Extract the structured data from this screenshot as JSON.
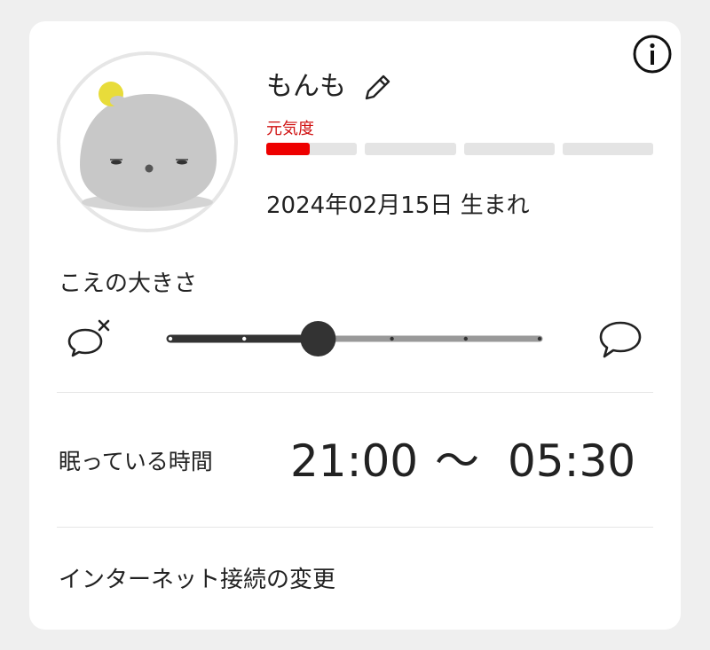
{
  "profile": {
    "name": "もんも",
    "energy_label": "元気度",
    "energy_level": 0.12,
    "energy_segments": 4,
    "birth_text": "2024年02月15日 生まれ"
  },
  "volume": {
    "label": "こえの大きさ",
    "steps": 6,
    "current_step": 2
  },
  "sleep": {
    "label": "眠っている時間",
    "start": "21:00",
    "separator": "～",
    "end": "05:30"
  },
  "network": {
    "label": "インターネット接続の変更"
  },
  "colors": {
    "energy_fill": "#ee0000",
    "energy_label": "#d01010",
    "slider_active": "#333333",
    "slider_inactive": "#999999"
  },
  "icons": {
    "info": "info-icon",
    "edit": "pencil-icon",
    "mute": "speech-bubble-muted-icon",
    "speak": "speech-bubble-icon"
  }
}
